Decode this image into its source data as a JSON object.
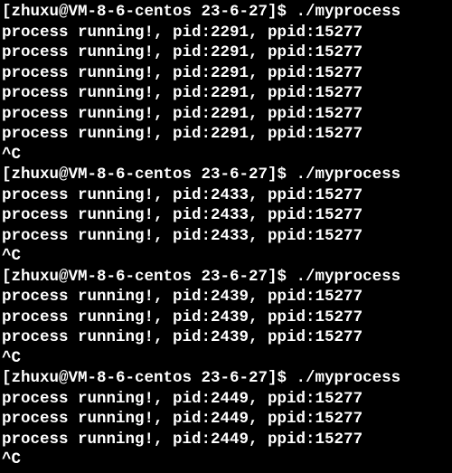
{
  "prompt_prefix": "[zhuxu@VM-8-6-centos 23-6-27]$ ",
  "command": "./myprocess",
  "interrupt": "^C",
  "runs": [
    {
      "pid": "2291",
      "ppid": "15277",
      "repeat": 6
    },
    {
      "pid": "2433",
      "ppid": "15277",
      "repeat": 3
    },
    {
      "pid": "2439",
      "ppid": "15277",
      "repeat": 3
    },
    {
      "pid": "2449",
      "ppid": "15277",
      "repeat": 3
    }
  ],
  "msg_template": "process running!, pid:{pid}, ppid:{ppid}"
}
